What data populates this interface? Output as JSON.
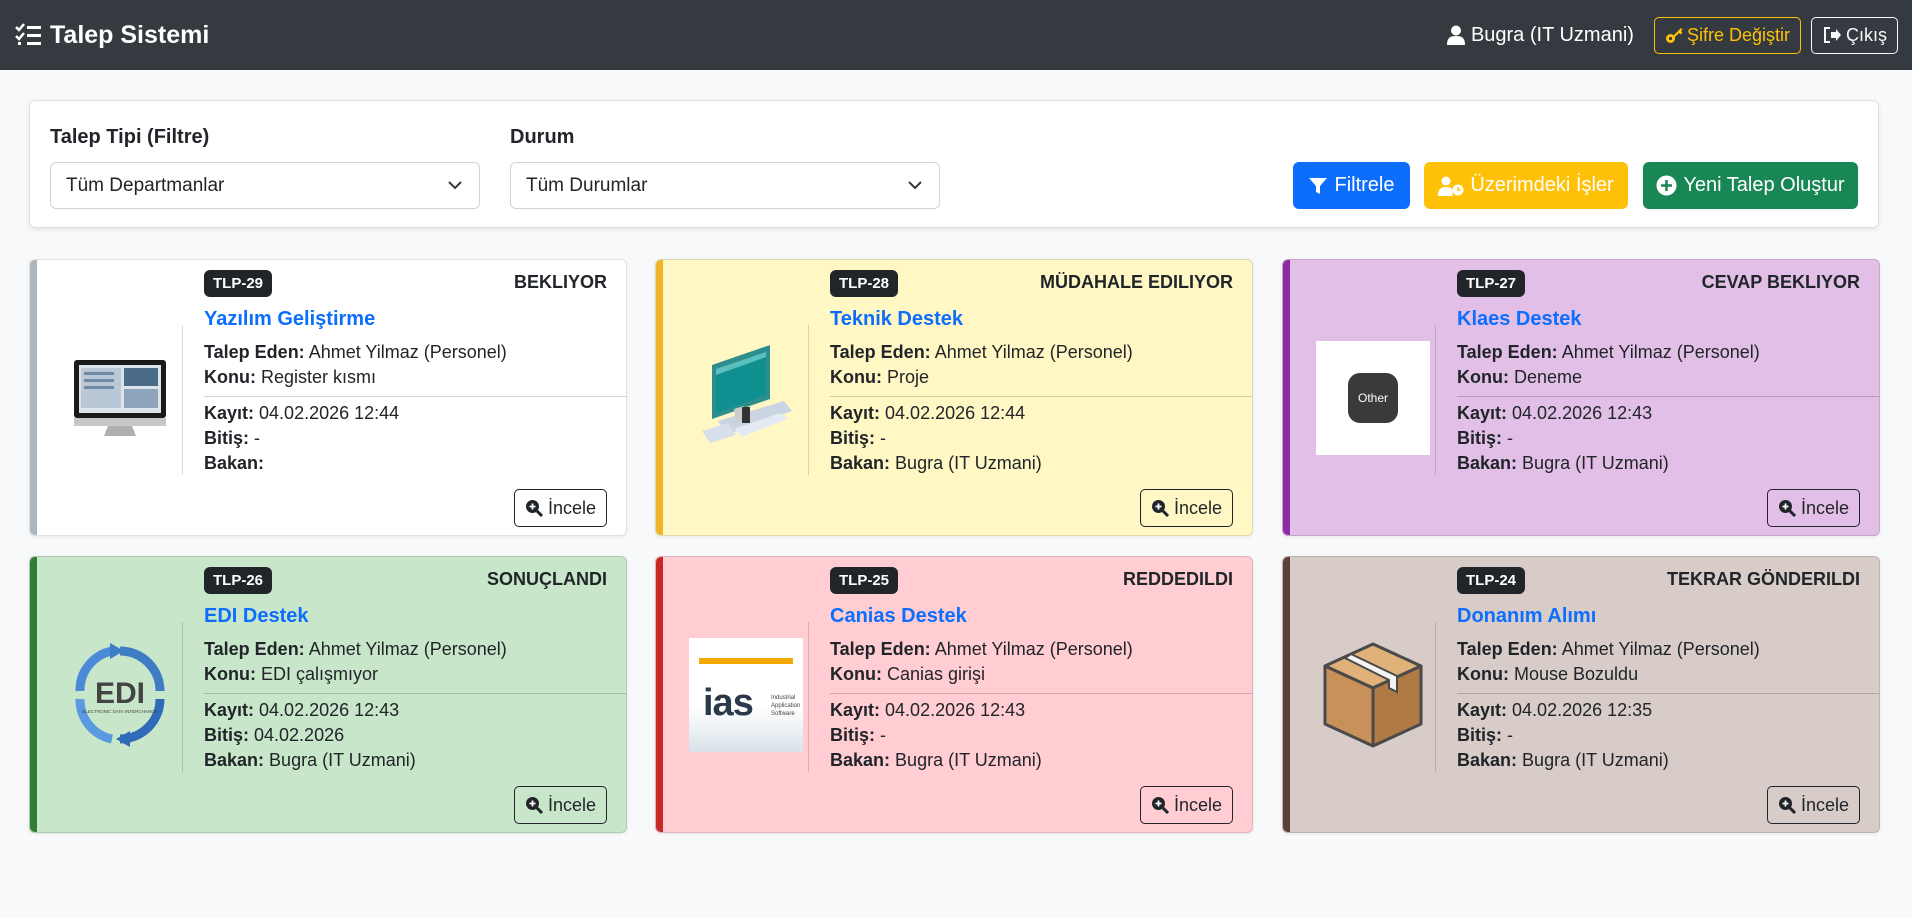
{
  "navbar": {
    "brand": "Talep Sistemi",
    "user": "Bugra (IT Uzmani)",
    "change_password": "Şifre Değiştir",
    "logout": "Çıkış"
  },
  "filters": {
    "type_label": "Talep Tipi (Filtre)",
    "type_value": "Tüm Departmanlar",
    "status_label": "Durum",
    "status_value": "Tüm Durumlar",
    "filter_button": "Filtrele",
    "my_tasks_button": "Üzerimdeki İşler",
    "new_request_button": "Yeni Talep Oluştur"
  },
  "labels": {
    "requester": "Talep Eden:",
    "subject": "Konu:",
    "created": "Kayıt:",
    "finished": "Bitiş:",
    "handler": "Bakan:",
    "inspect": "İncele"
  },
  "colors": {
    "navbar": "#343a40",
    "primary": "#0d6efd",
    "warning": "#ffc107",
    "success": "#198754"
  },
  "tickets": [
    {
      "code": "TLP-29",
      "status": "BEKLIYOR",
      "title": "Yazılım Geliştirme",
      "requester": "Ahmet Yilmaz (Personel)",
      "subject": "Register kısmı",
      "created": "04.02.2026 12:44",
      "finished": "-",
      "handler": "",
      "bg": "#ffffff",
      "accent": "#adb5bd",
      "icon": "monitor-icon"
    },
    {
      "code": "TLP-28",
      "status": "MÜDAHALE EDILIYOR",
      "title": "Teknik Destek",
      "requester": "Ahmet Yilmaz (Personel)",
      "subject": "Proje",
      "created": "04.02.2026 12:44",
      "finished": "-",
      "handler": "Bugra (IT Uzmani)",
      "bg": "#fff8c4",
      "accent": "#f0b429",
      "icon": "computer-icon"
    },
    {
      "code": "TLP-27",
      "status": "CEVAP BEKLIYOR",
      "title": "Klaes Destek",
      "requester": "Ahmet Yilmaz (Personel)",
      "subject": "Deneme",
      "created": "04.02.2026 12:43",
      "finished": "-",
      "handler": "Bugra (IT Uzmani)",
      "bg": "#e2bfe7",
      "accent": "#8e2aa3",
      "icon": "other-icon"
    },
    {
      "code": "TLP-26",
      "status": "SONUÇLANDI",
      "title": "EDI Destek",
      "requester": "Ahmet Yilmaz (Personel)",
      "subject": "EDI çalışmıyor",
      "created": "04.02.2026 12:43",
      "finished": "04.02.2026",
      "handler": "Bugra (IT Uzmani)",
      "bg": "#c8e6c9",
      "accent": "#2e7d32",
      "icon": "edi-icon"
    },
    {
      "code": "TLP-25",
      "status": "REDDEDILDI",
      "title": "Canias Destek",
      "requester": "Ahmet Yilmaz (Personel)",
      "subject": "Canias girişi",
      "created": "04.02.2026 12:43",
      "finished": "-",
      "handler": "Bugra (IT Uzmani)",
      "bg": "#ffcdd2",
      "accent": "#c62828",
      "icon": "ias-icon"
    },
    {
      "code": "TLP-24",
      "status": "TEKRAR GÖNDERILDI",
      "title": "Donanım Alımı",
      "requester": "Ahmet Yilmaz (Personel)",
      "subject": "Mouse Bozuldu",
      "created": "04.02.2026 12:35",
      "finished": "-",
      "handler": "Bugra (IT Uzmani)",
      "bg": "#d7ccc8",
      "accent": "#5d4037",
      "icon": "package-icon"
    }
  ],
  "thumbs": {
    "other_text": "Other",
    "edi_text": "EDI",
    "edi_sub": "ELECTRONIC DATA INTERCHANGE",
    "ias_text": "ias",
    "ias_sub1": "Industrial",
    "ias_sub2": "Application",
    "ias_sub3": "Software"
  }
}
